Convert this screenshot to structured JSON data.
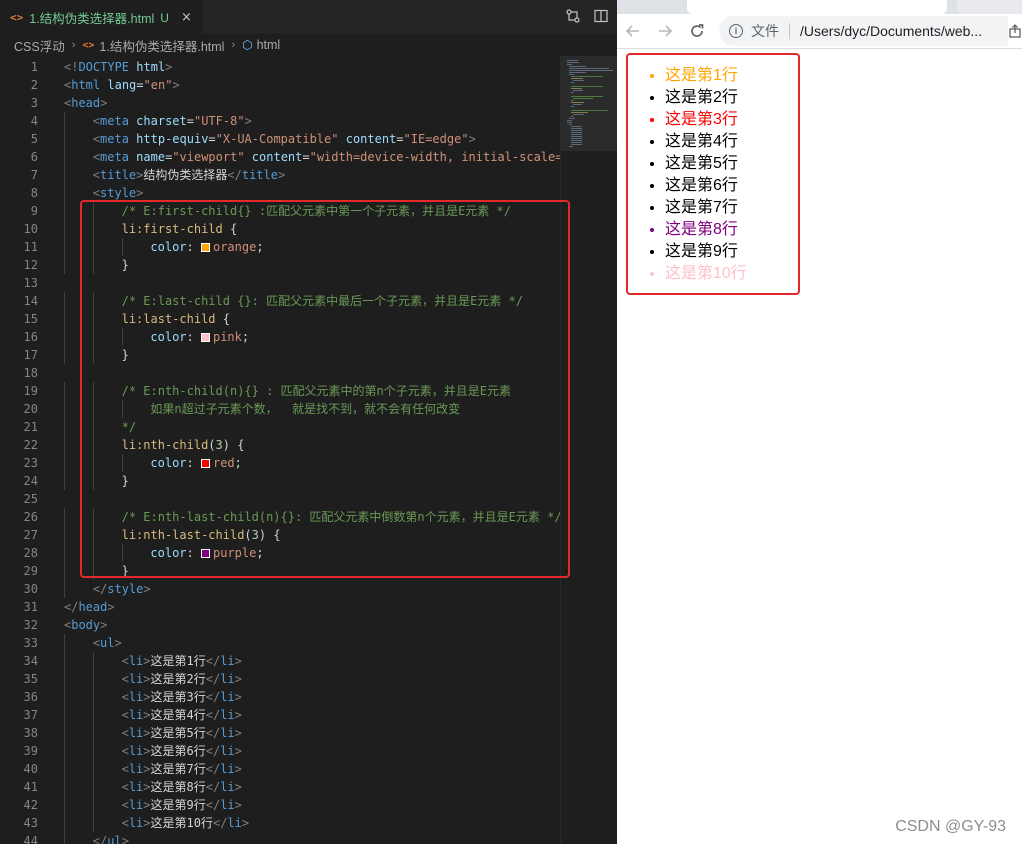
{
  "editor": {
    "tab": {
      "title": "1.结构伪类选择器.html",
      "badge": "U",
      "close": "×",
      "icon": "html-file-icon"
    },
    "breadcrumb": {
      "folder": "CSS浮动",
      "file": "1.结构伪类选择器.html",
      "element": "html"
    },
    "colors": {
      "background": "#1e1e1e",
      "tag": "#569cd6",
      "attribute": "#9cdcfe",
      "string": "#ce9178",
      "comment": "#6a9955",
      "selector": "#d7ba7d",
      "number": "#b5cea8"
    },
    "lines": [
      {
        "n": "1",
        "indent": 0,
        "tokens": [
          [
            "p",
            "<!"
          ],
          [
            "tg",
            "DOCTYPE"
          ],
          [
            "tx",
            " "
          ],
          [
            "at",
            "html"
          ],
          [
            "p",
            ">"
          ]
        ]
      },
      {
        "n": "2",
        "indent": 0,
        "tokens": [
          [
            "p",
            "<"
          ],
          [
            "tg",
            "html"
          ],
          [
            "tx",
            " "
          ],
          [
            "at",
            "lang"
          ],
          [
            "tx",
            "="
          ],
          [
            "st",
            "\"en\""
          ],
          [
            "p",
            ">"
          ]
        ]
      },
      {
        "n": "3",
        "indent": 0,
        "tokens": [
          [
            "p",
            "<"
          ],
          [
            "tg",
            "head"
          ],
          [
            "p",
            ">"
          ]
        ]
      },
      {
        "n": "4",
        "indent": 1,
        "tokens": [
          [
            "p",
            "<"
          ],
          [
            "tg",
            "meta"
          ],
          [
            "tx",
            " "
          ],
          [
            "at",
            "charset"
          ],
          [
            "tx",
            "="
          ],
          [
            "st",
            "\"UTF-8\""
          ],
          [
            "p",
            ">"
          ]
        ]
      },
      {
        "n": "5",
        "indent": 1,
        "tokens": [
          [
            "p",
            "<"
          ],
          [
            "tg",
            "meta"
          ],
          [
            "tx",
            " "
          ],
          [
            "at",
            "http-equiv"
          ],
          [
            "tx",
            "="
          ],
          [
            "st",
            "\"X-UA-Compatible\""
          ],
          [
            "tx",
            " "
          ],
          [
            "at",
            "content"
          ],
          [
            "tx",
            "="
          ],
          [
            "st",
            "\"IE=edge\""
          ],
          [
            "p",
            ">"
          ]
        ]
      },
      {
        "n": "6",
        "indent": 1,
        "tokens": [
          [
            "p",
            "<"
          ],
          [
            "tg",
            "meta"
          ],
          [
            "tx",
            " "
          ],
          [
            "at",
            "name"
          ],
          [
            "tx",
            "="
          ],
          [
            "st",
            "\"viewport\""
          ],
          [
            "tx",
            " "
          ],
          [
            "at",
            "content"
          ],
          [
            "tx",
            "="
          ],
          [
            "st",
            "\"width=device-width, initial-scale="
          ]
        ]
      },
      {
        "n": "7",
        "indent": 1,
        "tokens": [
          [
            "p",
            "<"
          ],
          [
            "tg",
            "title"
          ],
          [
            "p",
            ">"
          ],
          [
            "tx",
            "结构伪类选择器"
          ],
          [
            "p",
            "</"
          ],
          [
            "tg",
            "title"
          ],
          [
            "p",
            ">"
          ]
        ]
      },
      {
        "n": "8",
        "indent": 1,
        "tokens": [
          [
            "p",
            "<"
          ],
          [
            "tg",
            "style"
          ],
          [
            "p",
            ">"
          ]
        ]
      },
      {
        "n": "9",
        "indent": 2,
        "tokens": [
          [
            "cm",
            "/* E:first-child{} :匹配父元素中第一个子元素，并且是E元素 */"
          ]
        ]
      },
      {
        "n": "10",
        "indent": 2,
        "tokens": [
          [
            "sel",
            "li:first-child"
          ],
          [
            "tx",
            " {"
          ]
        ]
      },
      {
        "n": "11",
        "indent": 3,
        "tokens": [
          [
            "pr",
            "color"
          ],
          [
            "tx",
            ": "
          ],
          [
            "sw",
            "#ffa500"
          ],
          [
            "st",
            "orange"
          ],
          [
            "tx",
            ";"
          ]
        ]
      },
      {
        "n": "12",
        "indent": 2,
        "tokens": [
          [
            "tx",
            "}"
          ]
        ]
      },
      {
        "n": "13",
        "indent": 0,
        "tokens": []
      },
      {
        "n": "14",
        "indent": 2,
        "tokens": [
          [
            "cm",
            "/* E:last-child {}: 匹配父元素中最后一个子元素，并且是E元素 */"
          ]
        ]
      },
      {
        "n": "15",
        "indent": 2,
        "tokens": [
          [
            "sel",
            "li:last-child"
          ],
          [
            "tx",
            " {"
          ]
        ]
      },
      {
        "n": "16",
        "indent": 3,
        "tokens": [
          [
            "pr",
            "color"
          ],
          [
            "tx",
            ": "
          ],
          [
            "sw",
            "#ffc0cb"
          ],
          [
            "st",
            "pink"
          ],
          [
            "tx",
            ";"
          ]
        ]
      },
      {
        "n": "17",
        "indent": 2,
        "tokens": [
          [
            "tx",
            "}"
          ]
        ]
      },
      {
        "n": "18",
        "indent": 0,
        "tokens": []
      },
      {
        "n": "19",
        "indent": 2,
        "tokens": [
          [
            "cm",
            "/* E:nth-child(n){} : 匹配父元素中的第n个子元素，并且是E元素"
          ]
        ]
      },
      {
        "n": "20",
        "indent": 3,
        "tokens": [
          [
            "cm",
            "如果n超过子元素个数，  就是找不到，就不会有任何改变"
          ]
        ]
      },
      {
        "n": "21",
        "indent": 2,
        "tokens": [
          [
            "cm",
            "*/"
          ]
        ]
      },
      {
        "n": "22",
        "indent": 2,
        "tokens": [
          [
            "sel",
            "li:nth-child"
          ],
          [
            "tx",
            "("
          ],
          [
            "nm",
            "3"
          ],
          [
            "tx",
            ") {"
          ]
        ]
      },
      {
        "n": "23",
        "indent": 3,
        "tokens": [
          [
            "pr",
            "color"
          ],
          [
            "tx",
            ": "
          ],
          [
            "sw",
            "#ff0000"
          ],
          [
            "st",
            "red"
          ],
          [
            "tx",
            ";"
          ]
        ]
      },
      {
        "n": "24",
        "indent": 2,
        "tokens": [
          [
            "tx",
            "}"
          ]
        ]
      },
      {
        "n": "25",
        "indent": 0,
        "tokens": []
      },
      {
        "n": "26",
        "indent": 2,
        "tokens": [
          [
            "cm",
            "/* E:nth-last-child(n){}: 匹配父元素中倒数第n个元素，并且是E元素 */"
          ]
        ]
      },
      {
        "n": "27",
        "indent": 2,
        "tokens": [
          [
            "sel",
            "li:nth-last-child"
          ],
          [
            "tx",
            "("
          ],
          [
            "nm",
            "3"
          ],
          [
            "tx",
            ") {"
          ]
        ]
      },
      {
        "n": "28",
        "indent": 3,
        "tokens": [
          [
            "pr",
            "color"
          ],
          [
            "tx",
            ": "
          ],
          [
            "sw",
            "#800080"
          ],
          [
            "st",
            "purple"
          ],
          [
            "tx",
            ";"
          ]
        ]
      },
      {
        "n": "29",
        "indent": 2,
        "tokens": [
          [
            "tx",
            "}"
          ]
        ]
      },
      {
        "n": "30",
        "indent": 1,
        "tokens": [
          [
            "p",
            "</"
          ],
          [
            "tg",
            "style"
          ],
          [
            "p",
            ">"
          ]
        ]
      },
      {
        "n": "31",
        "indent": 0,
        "tokens": [
          [
            "p",
            "</"
          ],
          [
            "tg",
            "head"
          ],
          [
            "p",
            ">"
          ]
        ]
      },
      {
        "n": "32",
        "indent": 0,
        "tokens": [
          [
            "p",
            "<"
          ],
          [
            "tg",
            "body"
          ],
          [
            "p",
            ">"
          ]
        ]
      },
      {
        "n": "33",
        "indent": 1,
        "tokens": [
          [
            "p",
            "<"
          ],
          [
            "tg",
            "ul"
          ],
          [
            "p",
            ">"
          ]
        ]
      },
      {
        "n": "34",
        "indent": 2,
        "tokens": [
          [
            "p",
            "<"
          ],
          [
            "tg",
            "li"
          ],
          [
            "p",
            ">"
          ],
          [
            "tx",
            "这是第1行"
          ],
          [
            "p",
            "</"
          ],
          [
            "tg",
            "li"
          ],
          [
            "p",
            ">"
          ]
        ]
      },
      {
        "n": "35",
        "indent": 2,
        "tokens": [
          [
            "p",
            "<"
          ],
          [
            "tg",
            "li"
          ],
          [
            "p",
            ">"
          ],
          [
            "tx",
            "这是第2行"
          ],
          [
            "p",
            "</"
          ],
          [
            "tg",
            "li"
          ],
          [
            "p",
            ">"
          ]
        ]
      },
      {
        "n": "36",
        "indent": 2,
        "tokens": [
          [
            "p",
            "<"
          ],
          [
            "tg",
            "li"
          ],
          [
            "p",
            ">"
          ],
          [
            "tx",
            "这是第3行"
          ],
          [
            "p",
            "</"
          ],
          [
            "tg",
            "li"
          ],
          [
            "p",
            ">"
          ]
        ]
      },
      {
        "n": "37",
        "indent": 2,
        "tokens": [
          [
            "p",
            "<"
          ],
          [
            "tg",
            "li"
          ],
          [
            "p",
            ">"
          ],
          [
            "tx",
            "这是第4行"
          ],
          [
            "p",
            "</"
          ],
          [
            "tg",
            "li"
          ],
          [
            "p",
            ">"
          ]
        ]
      },
      {
        "n": "38",
        "indent": 2,
        "tokens": [
          [
            "p",
            "<"
          ],
          [
            "tg",
            "li"
          ],
          [
            "p",
            ">"
          ],
          [
            "tx",
            "这是第5行"
          ],
          [
            "p",
            "</"
          ],
          [
            "tg",
            "li"
          ],
          [
            "p",
            ">"
          ]
        ]
      },
      {
        "n": "39",
        "indent": 2,
        "tokens": [
          [
            "p",
            "<"
          ],
          [
            "tg",
            "li"
          ],
          [
            "p",
            ">"
          ],
          [
            "tx",
            "这是第6行"
          ],
          [
            "p",
            "</"
          ],
          [
            "tg",
            "li"
          ],
          [
            "p",
            ">"
          ]
        ]
      },
      {
        "n": "40",
        "indent": 2,
        "tokens": [
          [
            "p",
            "<"
          ],
          [
            "tg",
            "li"
          ],
          [
            "p",
            ">"
          ],
          [
            "tx",
            "这是第7行"
          ],
          [
            "p",
            "</"
          ],
          [
            "tg",
            "li"
          ],
          [
            "p",
            ">"
          ]
        ]
      },
      {
        "n": "41",
        "indent": 2,
        "tokens": [
          [
            "p",
            "<"
          ],
          [
            "tg",
            "li"
          ],
          [
            "p",
            ">"
          ],
          [
            "tx",
            "这是第8行"
          ],
          [
            "p",
            "</"
          ],
          [
            "tg",
            "li"
          ],
          [
            "p",
            ">"
          ]
        ]
      },
      {
        "n": "42",
        "indent": 2,
        "tokens": [
          [
            "p",
            "<"
          ],
          [
            "tg",
            "li"
          ],
          [
            "p",
            ">"
          ],
          [
            "tx",
            "这是第9行"
          ],
          [
            "p",
            "</"
          ],
          [
            "tg",
            "li"
          ],
          [
            "p",
            ">"
          ]
        ]
      },
      {
        "n": "43",
        "indent": 2,
        "tokens": [
          [
            "p",
            "<"
          ],
          [
            "tg",
            "li"
          ],
          [
            "p",
            ">"
          ],
          [
            "tx",
            "这是第10行"
          ],
          [
            "p",
            "</"
          ],
          [
            "tg",
            "li"
          ],
          [
            "p",
            ">"
          ]
        ]
      },
      {
        "n": "44",
        "indent": 1,
        "tokens": [
          [
            "p",
            "</"
          ],
          [
            "tg",
            "ul"
          ],
          [
            "p",
            ">"
          ]
        ]
      }
    ]
  },
  "browser": {
    "omnibox": {
      "scheme_label": "文件",
      "url": "/Users/dyc/Documents/web..."
    },
    "list_items": [
      {
        "text": "这是第1行",
        "color": "#ffa500"
      },
      {
        "text": "这是第2行",
        "color": "#000000"
      },
      {
        "text": "这是第3行",
        "color": "#ff0000"
      },
      {
        "text": "这是第4行",
        "color": "#000000"
      },
      {
        "text": "这是第5行",
        "color": "#000000"
      },
      {
        "text": "这是第6行",
        "color": "#000000"
      },
      {
        "text": "这是第7行",
        "color": "#000000"
      },
      {
        "text": "这是第8行",
        "color": "#800080"
      },
      {
        "text": "这是第9行",
        "color": "#000000"
      },
      {
        "text": "这是第10行",
        "color": "#ffc0cb"
      }
    ]
  },
  "annotation_color": "#e3292a",
  "watermark": "CSDN @GY-93"
}
